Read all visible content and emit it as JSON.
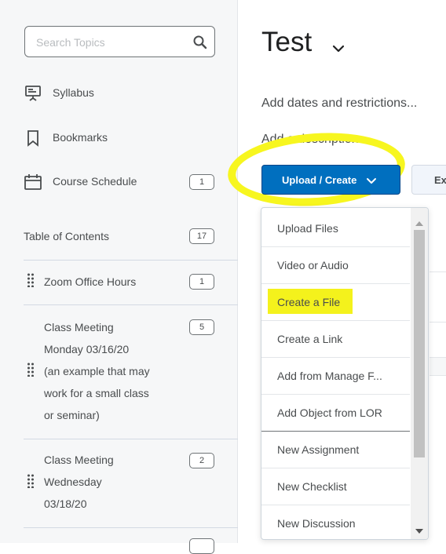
{
  "sidebar": {
    "search": {
      "placeholder": "Search Topics"
    },
    "items": [
      {
        "label": "Syllabus"
      },
      {
        "label": "Bookmarks"
      },
      {
        "label": "Course Schedule",
        "badge": "1"
      }
    ],
    "toc": {
      "label": "Table of Contents",
      "badge": "17"
    },
    "modules": [
      {
        "lines": [
          "Zoom Office Hours"
        ],
        "badge": "1"
      },
      {
        "lines": [
          "Class Meeting",
          "Monday 03/16/20",
          "(an example that may",
          "work for a small class",
          "or seminar)"
        ],
        "badge": "5"
      },
      {
        "lines": [
          "Class Meeting",
          "Wednesday",
          "03/18/20"
        ],
        "badge": "2"
      }
    ]
  },
  "main": {
    "title": "Test",
    "dates_link": "Add dates and restrictions...",
    "description_link": "Add a description...",
    "upload_button": "Upload / Create",
    "next_button_partial": "Ex"
  },
  "dropdown": {
    "items": [
      "Upload Files",
      "Video or Audio",
      "Create a File",
      "Create a Link",
      "Add from Manage F...",
      "Add Object from LOR",
      "New Assignment",
      "New Checklist",
      "New Discussion"
    ],
    "highlighted_item": "Create a File"
  },
  "colors": {
    "primary_button": "#006fbf",
    "highlighter": "#f7f61f",
    "sidebar_bg": "#f6f7f8"
  }
}
